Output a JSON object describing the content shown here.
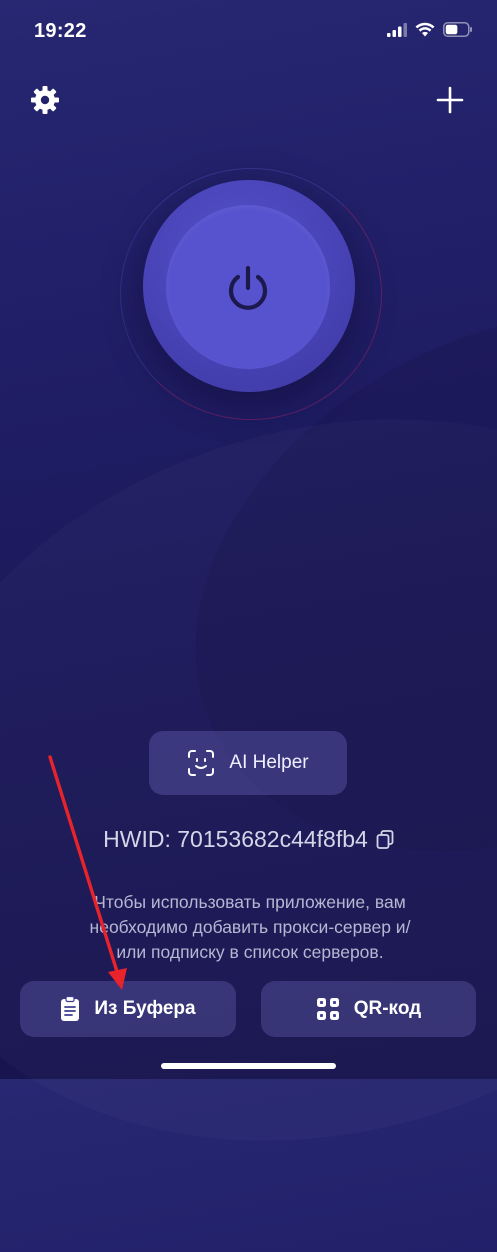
{
  "status_bar": {
    "time": "19:22",
    "battery_level": 0.55
  },
  "toolbar": {
    "settings_icon": "gear-icon",
    "add_icon": "plus-icon"
  },
  "connect": {
    "power_icon": "power-icon",
    "accent": "#5753cf"
  },
  "ai_helper": {
    "label": "AI Helper",
    "icon": "face-scan-icon"
  },
  "hwid": {
    "text": "HWID: 70153682c44f8fb4",
    "copy_icon": "copy-icon"
  },
  "hint": {
    "line1": "Чтобы использовать приложение, вам",
    "line2": "необходимо добавить прокси-сервер и/",
    "line3": "или подписку в список серверов."
  },
  "actions": {
    "clipboard_label": "Из Буфера",
    "clipboard_icon": "clipboard-icon",
    "qr_label": "QR-код",
    "qr_icon": "qr-code-icon"
  },
  "annotation": {
    "arrow_color": "#e8232b"
  }
}
